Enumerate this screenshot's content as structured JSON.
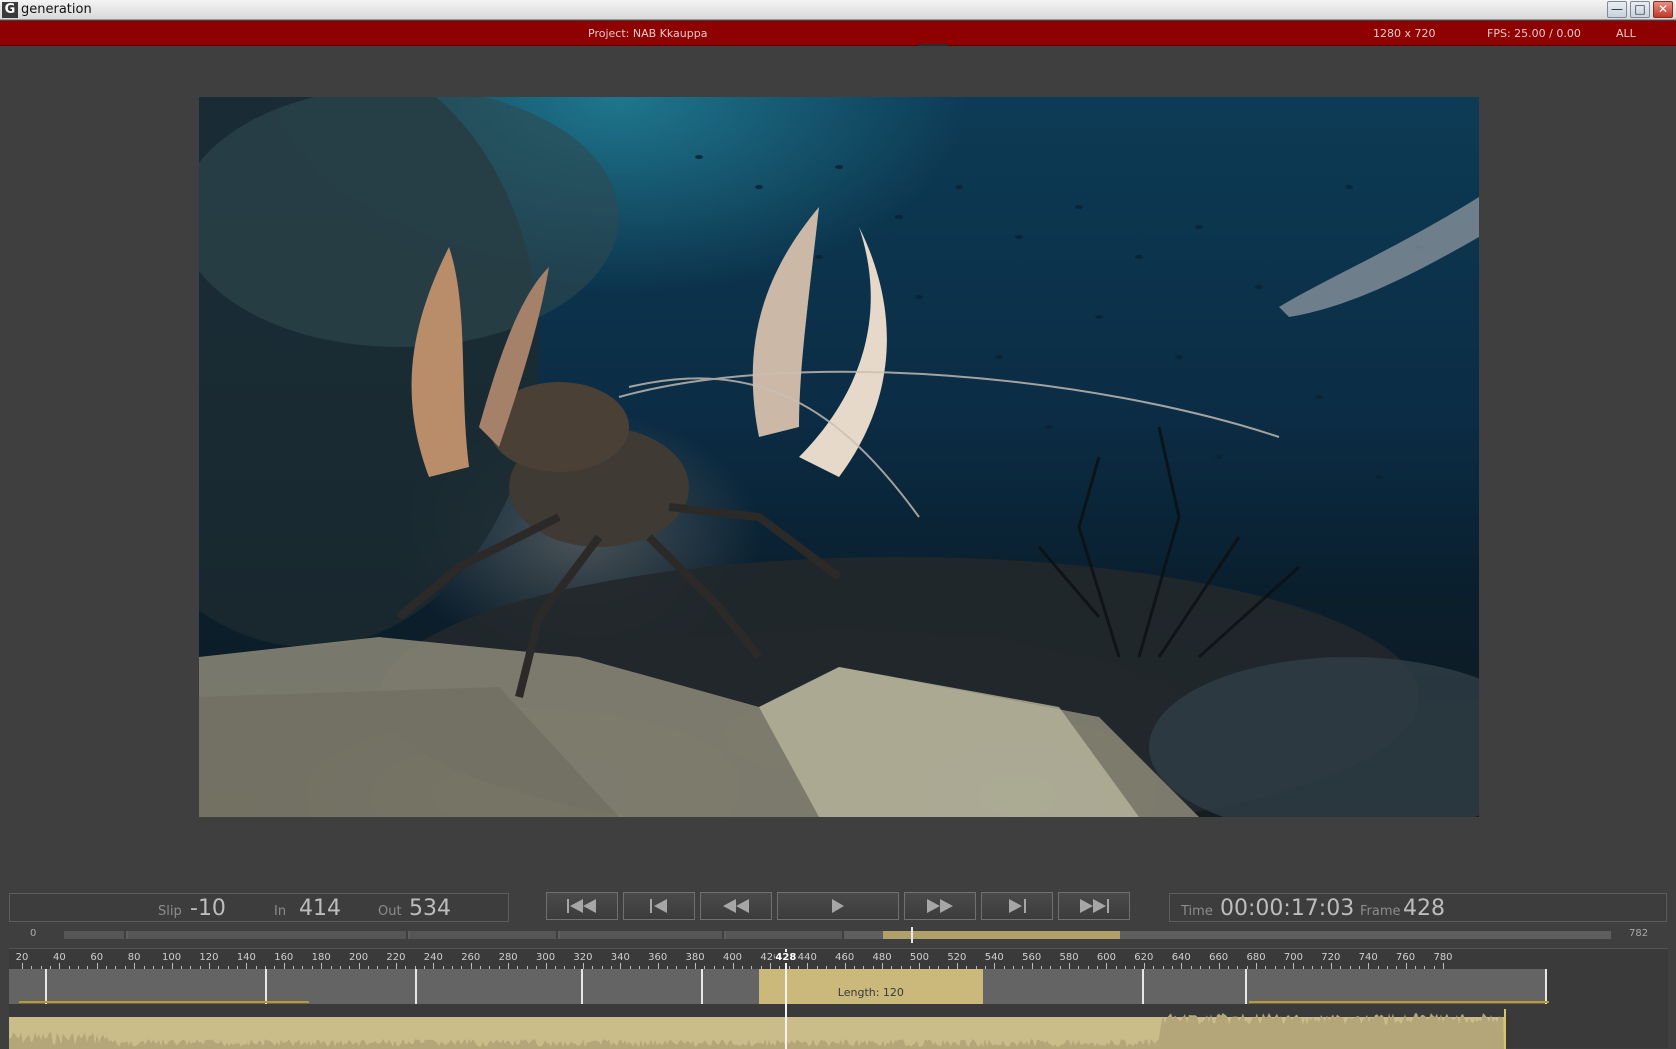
{
  "window": {
    "title": "generation",
    "app_icon": "G"
  },
  "status": {
    "project": "Project: NAB Kkauppa",
    "resolution": "1280 x 720",
    "fps": "FPS: 25.00 / 0.00",
    "mode": "ALL"
  },
  "viewer": {
    "description_icon": "video-frame"
  },
  "left_panel": {
    "slip_label": "Slip",
    "slip_value": "-10",
    "in_label": "In",
    "in_value": "414",
    "out_label": "Out",
    "out_value": "534"
  },
  "right_panel": {
    "time_label": "Time",
    "time_value": "00:00:17:03",
    "frame_label": "Frame",
    "frame_value": "428"
  },
  "transport": [
    "go-to-start",
    "step-back",
    "rewind",
    "play",
    "fast-forward",
    "step-forward",
    "go-to-end"
  ],
  "scrubber": {
    "start": "0",
    "end": "782",
    "position": 428,
    "highlight_start": 414,
    "highlight_end": 534
  },
  "timeline": {
    "ruler_labels": [
      "20",
      "40",
      "60",
      "80",
      "100",
      "120",
      "140",
      "160",
      "180",
      "200",
      "220",
      "240",
      "260",
      "280",
      "300",
      "320",
      "340",
      "360",
      "380",
      "400",
      "420",
      "440",
      "460",
      "480",
      "500",
      "520",
      "540",
      "560",
      "580",
      "600",
      "620",
      "640",
      "660",
      "680",
      "700",
      "720",
      "740",
      "760",
      "780"
    ],
    "playhead_frame": "428",
    "clip_label": "Length: 120",
    "clip_in": 414,
    "clip_out": 534
  }
}
